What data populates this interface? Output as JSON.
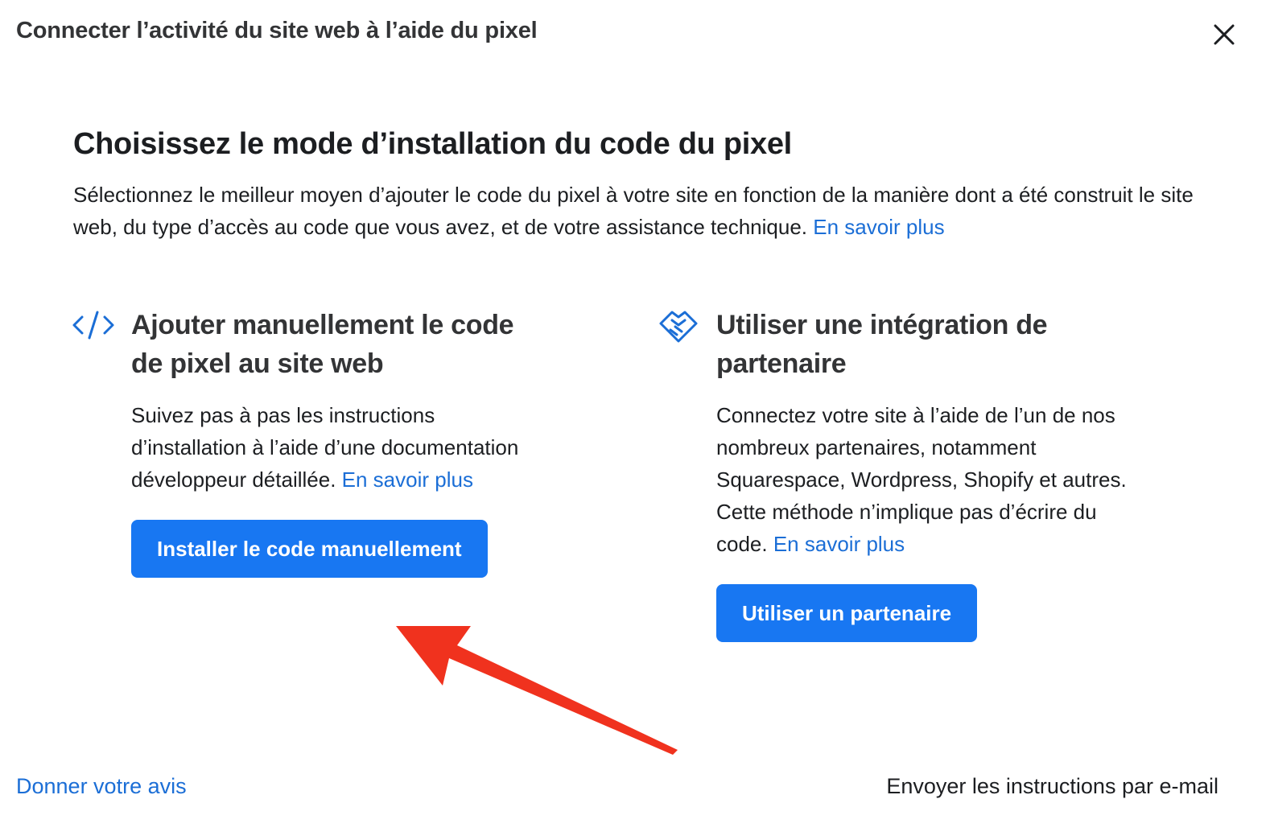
{
  "dialog": {
    "title": "Connecter l’activité du site web à l’aide du pixel",
    "close_icon": "close-icon"
  },
  "main": {
    "heading": "Choisissez le mode d’installation du code du pixel",
    "intro_text": "Sélectionnez le meilleur moyen d’ajouter le code du pixel à votre site en fonction de la manière dont a été construit le site web, du type d’accès au code que vous avez, et de votre assistance technique.",
    "intro_link": "En savoir plus"
  },
  "options": [
    {
      "icon": "code-icon",
      "title": "Ajouter manuellement le code de pixel au site web",
      "description": "Suivez pas à pas les instructions d’installation à l’aide d’une documentation développeur détaillée.",
      "link": "En savoir plus",
      "button": "Installer le code manuellement"
    },
    {
      "icon": "handshake-icon",
      "title": "Utiliser une intégration de partenaire",
      "description": "Connectez votre site à l’aide de l’un de nos nombreux partenaires, notamment Squarespace, Wordpress, Shopify et autres. Cette méthode n’implique pas d’écrire du code.",
      "link": "En savoir plus",
      "button": "Utiliser un partenaire"
    }
  ],
  "footer": {
    "feedback_link": "Donner votre avis",
    "email_link": "Envoyer les instructions par e-mail"
  },
  "colors": {
    "primary": "#1877f2",
    "link": "#1b6ed6",
    "annotation_arrow": "#f0321e"
  }
}
